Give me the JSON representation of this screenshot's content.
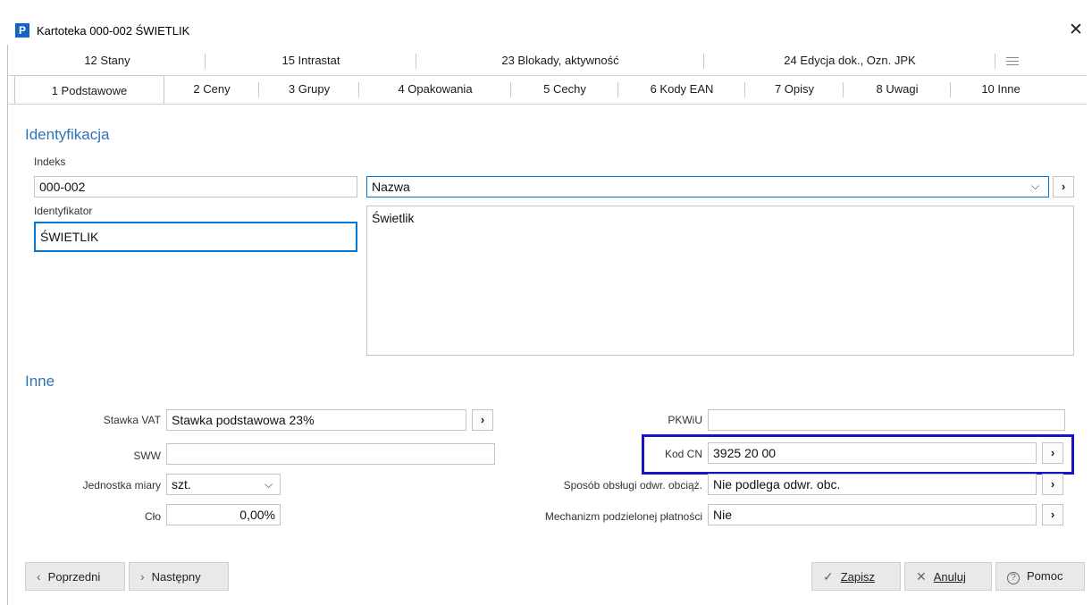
{
  "window": {
    "app_icon": "P",
    "title": "Kartoteka 000-002 ŚWIETLIK",
    "close_glyph": "✕"
  },
  "tabs_row1": [
    {
      "label": "12 Stany",
      "mnemonic_index": 4
    },
    {
      "label": "15 Intrastat",
      "mnemonic_index": 3
    },
    {
      "label": "23 Blokady, aktywność",
      "mnemonic_index": 3
    },
    {
      "label": "24 Edycja dok., Ozn. JPK",
      "mnemonic_index": -1
    }
  ],
  "tabs_row2": [
    {
      "label": "1 Podstawowe",
      "active": true
    },
    {
      "label": "2 Ceny",
      "active": false
    },
    {
      "label": "3 Grupy",
      "active": false
    },
    {
      "label": "4 Opakowania",
      "active": false
    },
    {
      "label": "5 Cechy",
      "active": false
    },
    {
      "label": "6 Kody EAN",
      "active": false
    },
    {
      "label": "7 Opisy",
      "active": false
    },
    {
      "label": "8 Uwagi",
      "active": false
    },
    {
      "label": "10 Inne",
      "active": false
    }
  ],
  "identyfikacja": {
    "title": "Identyfikacja",
    "indeks_label": "Indeks",
    "indeks_value": "000-002",
    "identyfikator_label": "Identyfikator",
    "identyfikator_value": "ŚWIETLIK",
    "nazwa_select_value": "Nazwa",
    "nazwa_text": "Świetlik"
  },
  "inne": {
    "title": "Inne",
    "stawka_vat_label": "Stawka VAT",
    "stawka_vat_value": "Stawka podstawowa 23%",
    "sww_label": "SWW",
    "sww_value": "",
    "jednostka_label": "Jednostka miary",
    "jednostka_value": "szt.",
    "clo_label": "Cło",
    "clo_value": "0,00%",
    "pkwiu_label": "PKWiU",
    "pkwiu_value": "",
    "kod_cn_label": "Kod CN",
    "kod_cn_value": "3925 20 00",
    "sposob_label": "Sposób obsługi odwr. obciąż.",
    "sposob_value": "Nie podlega odwr. obc.",
    "mechanizm_label": "Mechanizm podzielonej płatności",
    "mechanizm_value": "Nie"
  },
  "buttons": {
    "poprzedni": "Poprzedni",
    "nastepny": "Następny",
    "zapisz": "Zapisz",
    "anuluj": "Anuluj",
    "pomoc": "Pomoc"
  },
  "glyphs": {
    "chevron_right": "›",
    "chevron_down": "⌵",
    "arrow_left": "‹",
    "check": "✓",
    "cross": "✕",
    "help": "?"
  },
  "colors": {
    "section_title": "#2e74b5",
    "focus_border": "#0078d7",
    "highlight_box": "#1515c8",
    "app_icon_bg": "#1565c0"
  }
}
